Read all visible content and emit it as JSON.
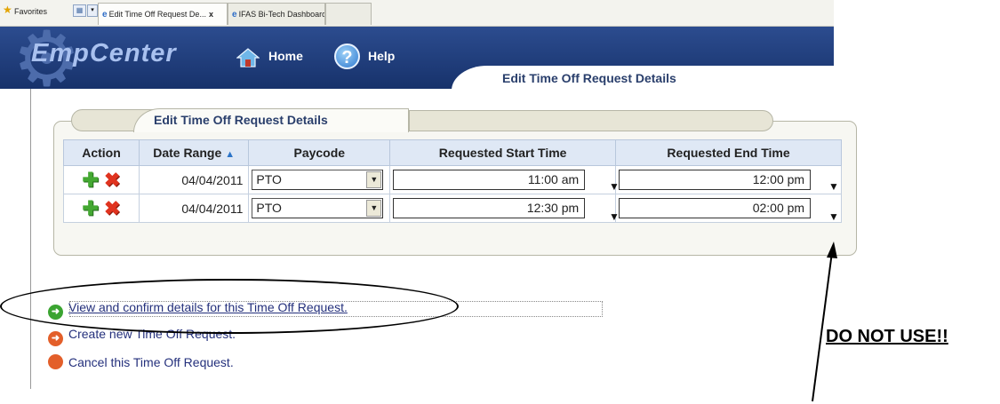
{
  "browser": {
    "favorites_label": "Favorites",
    "tabs": [
      {
        "label": "Edit Time Off Request De...",
        "close": "x"
      },
      {
        "label": "IFAS Bi-Tech Dashboard"
      }
    ]
  },
  "header": {
    "logo": "EmpCenter",
    "home_label": "Home",
    "help_label": "Help",
    "page_title": "Edit Time Off Request Details"
  },
  "panel": {
    "title": "Edit Time Off Request Details",
    "columns": [
      "Action",
      "Date Range",
      "Paycode",
      "Requested Start Time",
      "Requested End Time"
    ],
    "rows": [
      {
        "date": "04/04/2011",
        "paycode": "PTO",
        "start": "11:00 am",
        "end": "12:00 pm"
      },
      {
        "date": "04/04/2011",
        "paycode": "PTO",
        "start": "12:30 pm",
        "end": "02:00 pm"
      }
    ]
  },
  "links": {
    "view": "View and confirm details for this Time Off Request.",
    "create": "Create new Time Off Request.",
    "cancel": "Cancel this Time Off Request."
  },
  "annotation": {
    "warning": "DO NOT USE!!"
  },
  "colors": {
    "header_blue": "#1f3d7d",
    "link_navy": "#24307c",
    "table_header_bg": "#dfe8f5"
  }
}
